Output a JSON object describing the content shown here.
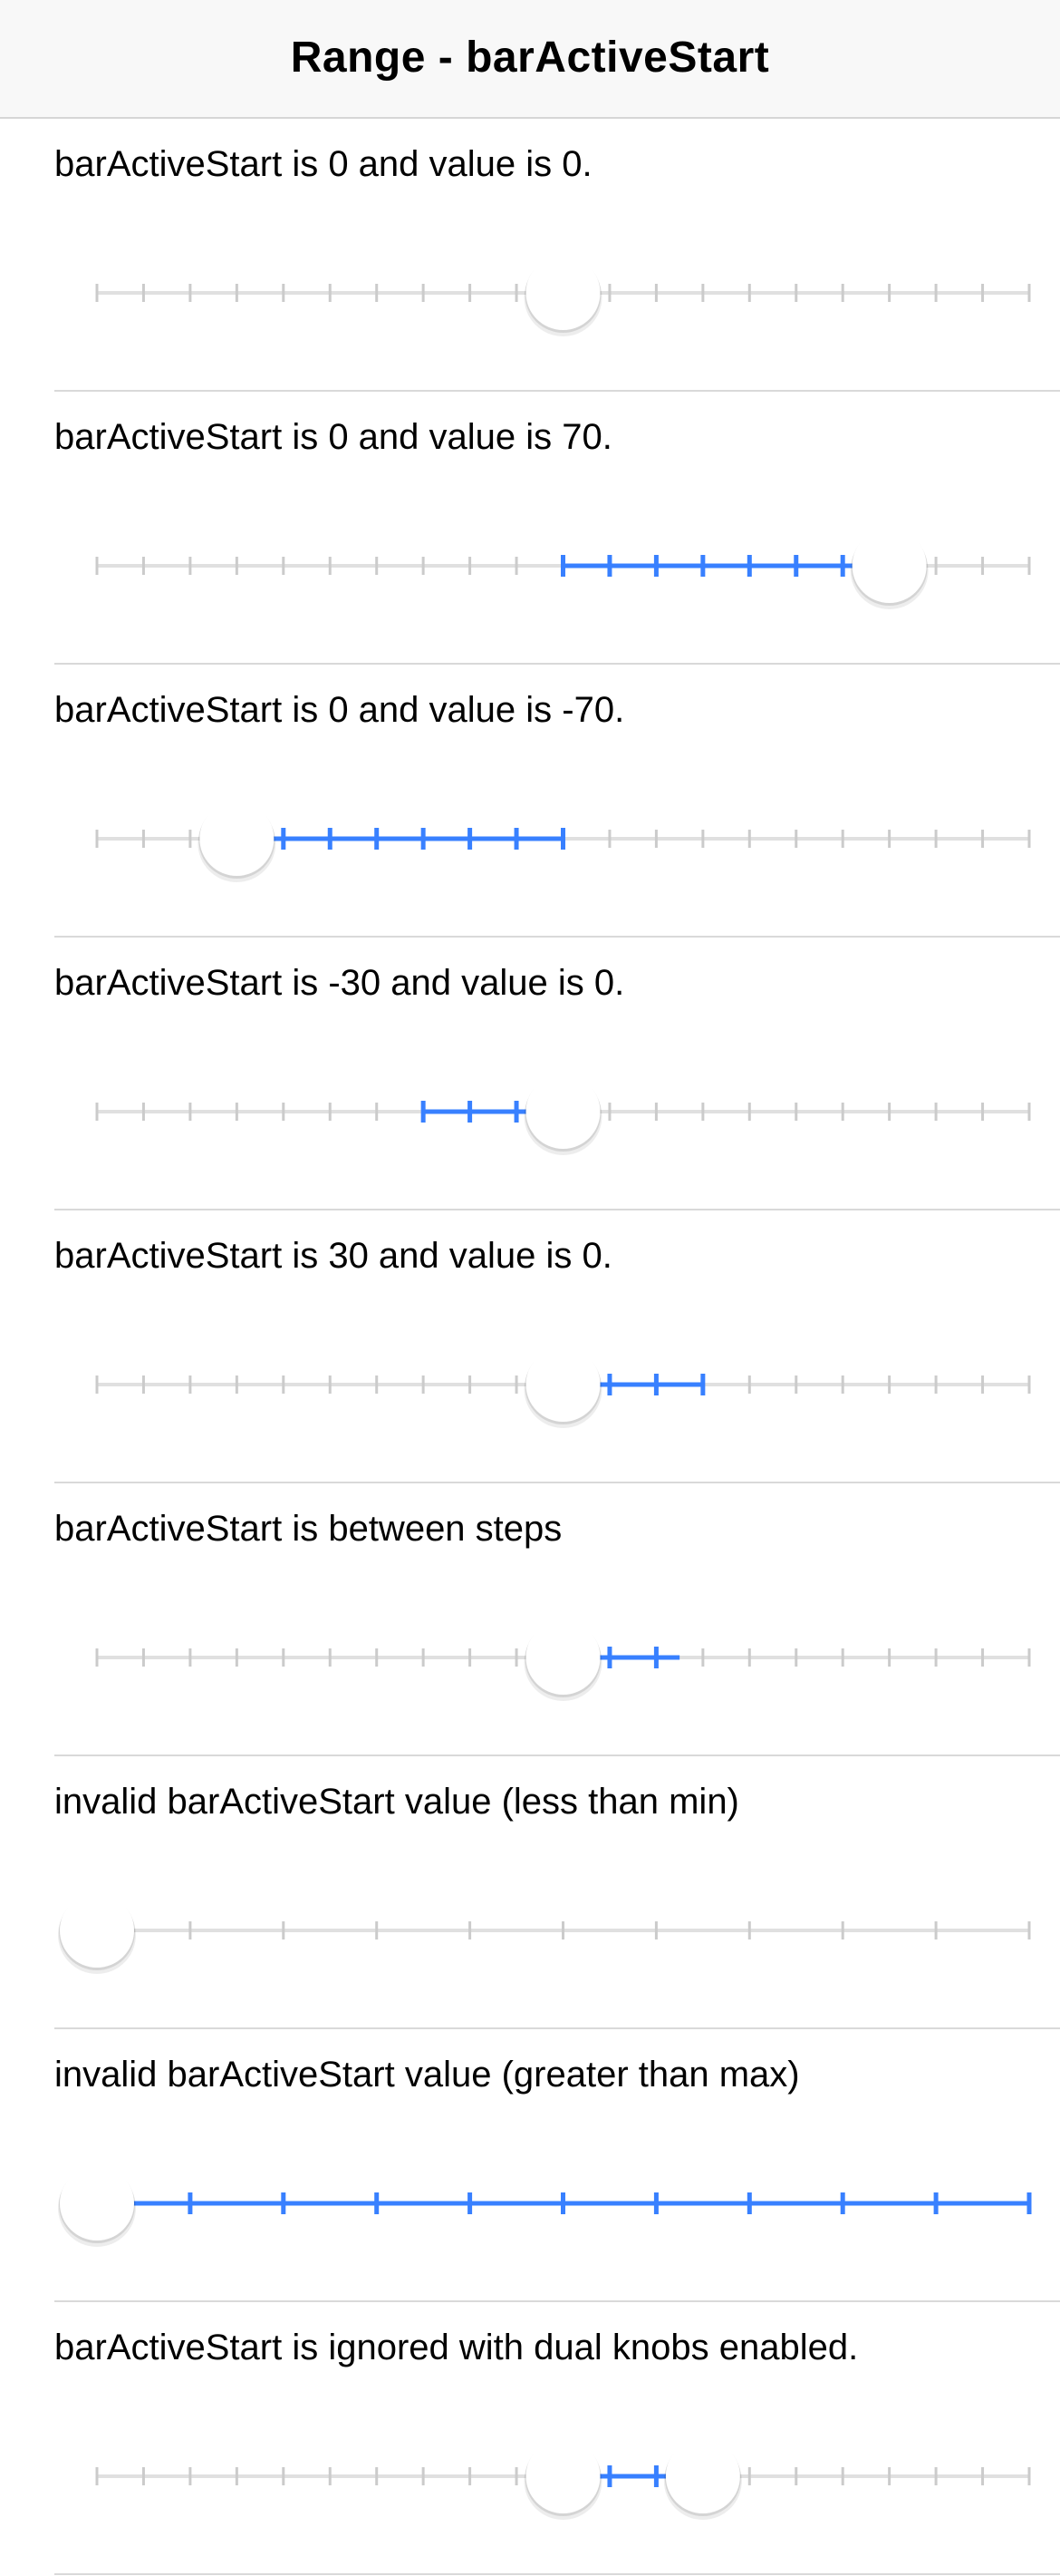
{
  "header": {
    "title": "Range - barActiveStart"
  },
  "colors": {
    "bar_inactive": "#e0e0e0",
    "tick_inactive": "#cbcbcb",
    "bar_active": "#3880ff",
    "knob": "#ffffff",
    "header_bg": "#f8f8f8",
    "separator": "#d9d9d9"
  },
  "ranges": [
    {
      "label": "barActiveStart is 0 and value is 0.",
      "min": -100,
      "max": 100,
      "step": 10,
      "bar_active_start": 0,
      "value": 0
    },
    {
      "label": "barActiveStart is 0 and value is 70.",
      "min": -100,
      "max": 100,
      "step": 10,
      "bar_active_start": 0,
      "value": 70
    },
    {
      "label": "barActiveStart is 0 and value is -70.",
      "min": -100,
      "max": 100,
      "step": 10,
      "bar_active_start": 0,
      "value": -70
    },
    {
      "label": "barActiveStart is -30 and value is 0.",
      "min": -100,
      "max": 100,
      "step": 10,
      "bar_active_start": -30,
      "value": 0
    },
    {
      "label": "barActiveStart is 30 and value is 0.",
      "min": -100,
      "max": 100,
      "step": 10,
      "bar_active_start": 30,
      "value": 0
    },
    {
      "label": "barActiveStart is between steps",
      "min": -100,
      "max": 100,
      "step": 10,
      "bar_active_start": 25,
      "value": 0
    },
    {
      "label": "invalid barActiveStart value (less than min)",
      "min": 0,
      "max": 100,
      "step": 10,
      "bar_active_start": 0,
      "value": 0
    },
    {
      "label": "invalid barActiveStart value (greater than max)",
      "min": 0,
      "max": 100,
      "step": 10,
      "bar_active_start": 100,
      "value": 0
    },
    {
      "label": "barActiveStart is ignored with dual knobs enabled.",
      "min": -100,
      "max": 100,
      "step": 10,
      "dual_knobs": true,
      "value_lower": 0,
      "value_upper": 30
    }
  ]
}
